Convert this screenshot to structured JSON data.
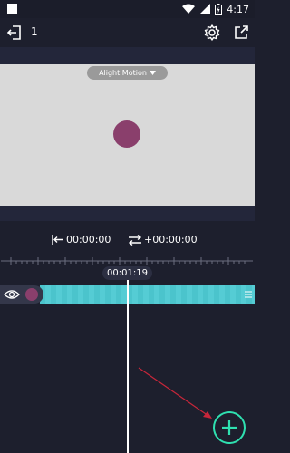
{
  "status_bar": {
    "time": "4:17"
  },
  "toolbar": {
    "project_name": "1",
    "exit_icon": "exit-icon",
    "settings_icon": "gear-icon",
    "export_icon": "export-icon"
  },
  "preview": {
    "watermark": "Alight Motion",
    "object_color": "#8a3f6c"
  },
  "timecodes": {
    "start": "00:00:00",
    "offset": "+00:00:00",
    "playhead": "00:01:19"
  },
  "timeline": {
    "layer_color": "#4bc4cc",
    "accent": "#2fe0b0"
  }
}
